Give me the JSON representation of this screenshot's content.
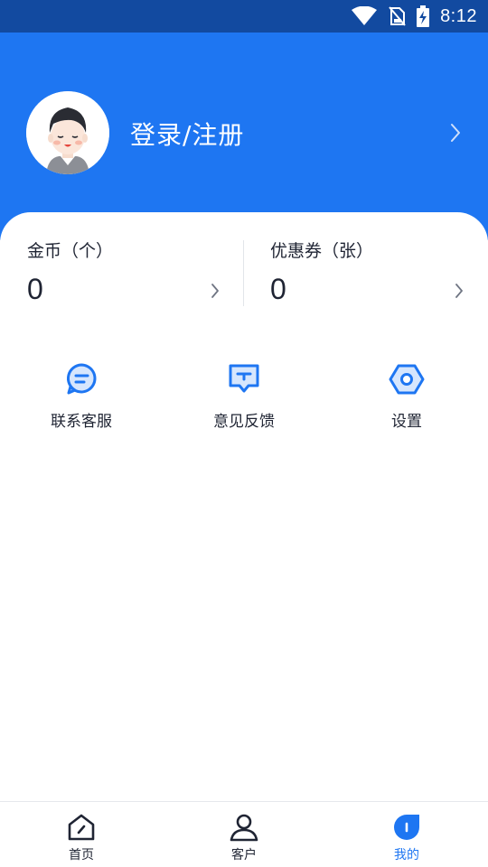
{
  "status_bar": {
    "time": "8:12",
    "icons": [
      "wifi-icon",
      "no-sim-icon",
      "battery-charging-icon"
    ]
  },
  "header": {
    "login_label": "登录/注册",
    "avatar_icon": "user-avatar-icon",
    "chevron_icon": "chevron-right-icon",
    "background_color": "#1e76f2"
  },
  "stats": {
    "coins": {
      "label": "金币（个）",
      "value": "0"
    },
    "coupons": {
      "label": "优惠券（张）",
      "value": "0"
    }
  },
  "actions": [
    {
      "label": "联系客服",
      "icon": "chat-icon"
    },
    {
      "label": "意见反馈",
      "icon": "feedback-icon"
    },
    {
      "label": "设置",
      "icon": "settings-icon"
    }
  ],
  "bottom_nav": {
    "items": [
      {
        "label": "首页",
        "icon": "home-icon"
      },
      {
        "label": "客户",
        "icon": "customer-icon"
      },
      {
        "label": "我的",
        "icon": "mine-icon",
        "active": true
      }
    ],
    "active_color": "#1e76f2"
  }
}
